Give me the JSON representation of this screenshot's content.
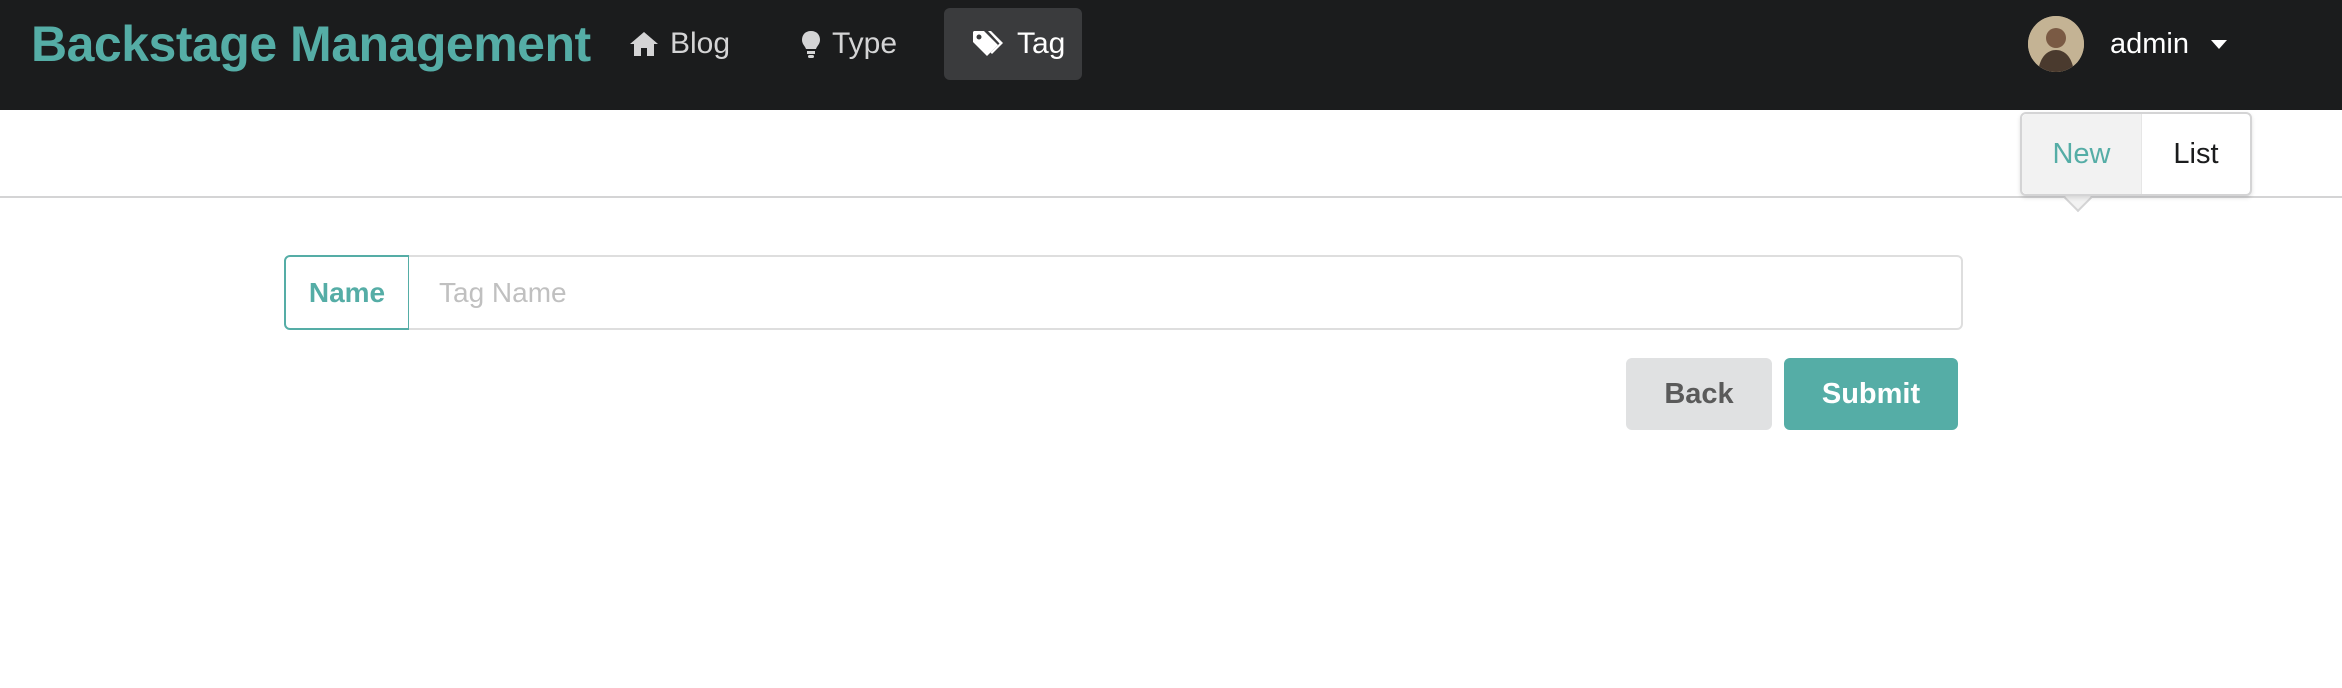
{
  "header": {
    "brand": "Backstage Management",
    "nav": [
      {
        "label": "Blog",
        "icon": "home-icon",
        "active": false
      },
      {
        "label": "Type",
        "icon": "lightbulb-icon",
        "active": false
      },
      {
        "label": "Tag",
        "icon": "tags-icon",
        "active": true
      }
    ],
    "user": {
      "name": "admin"
    }
  },
  "submenu": {
    "items": [
      {
        "label": "New",
        "active": true
      },
      {
        "label": "List",
        "active": false
      }
    ]
  },
  "form": {
    "name_label": "Name",
    "name_placeholder": "Tag Name",
    "name_value": ""
  },
  "buttons": {
    "back": "Back",
    "submit": "Submit"
  },
  "colors": {
    "accent": "#55ada6",
    "topbar": "#1b1c1d"
  }
}
